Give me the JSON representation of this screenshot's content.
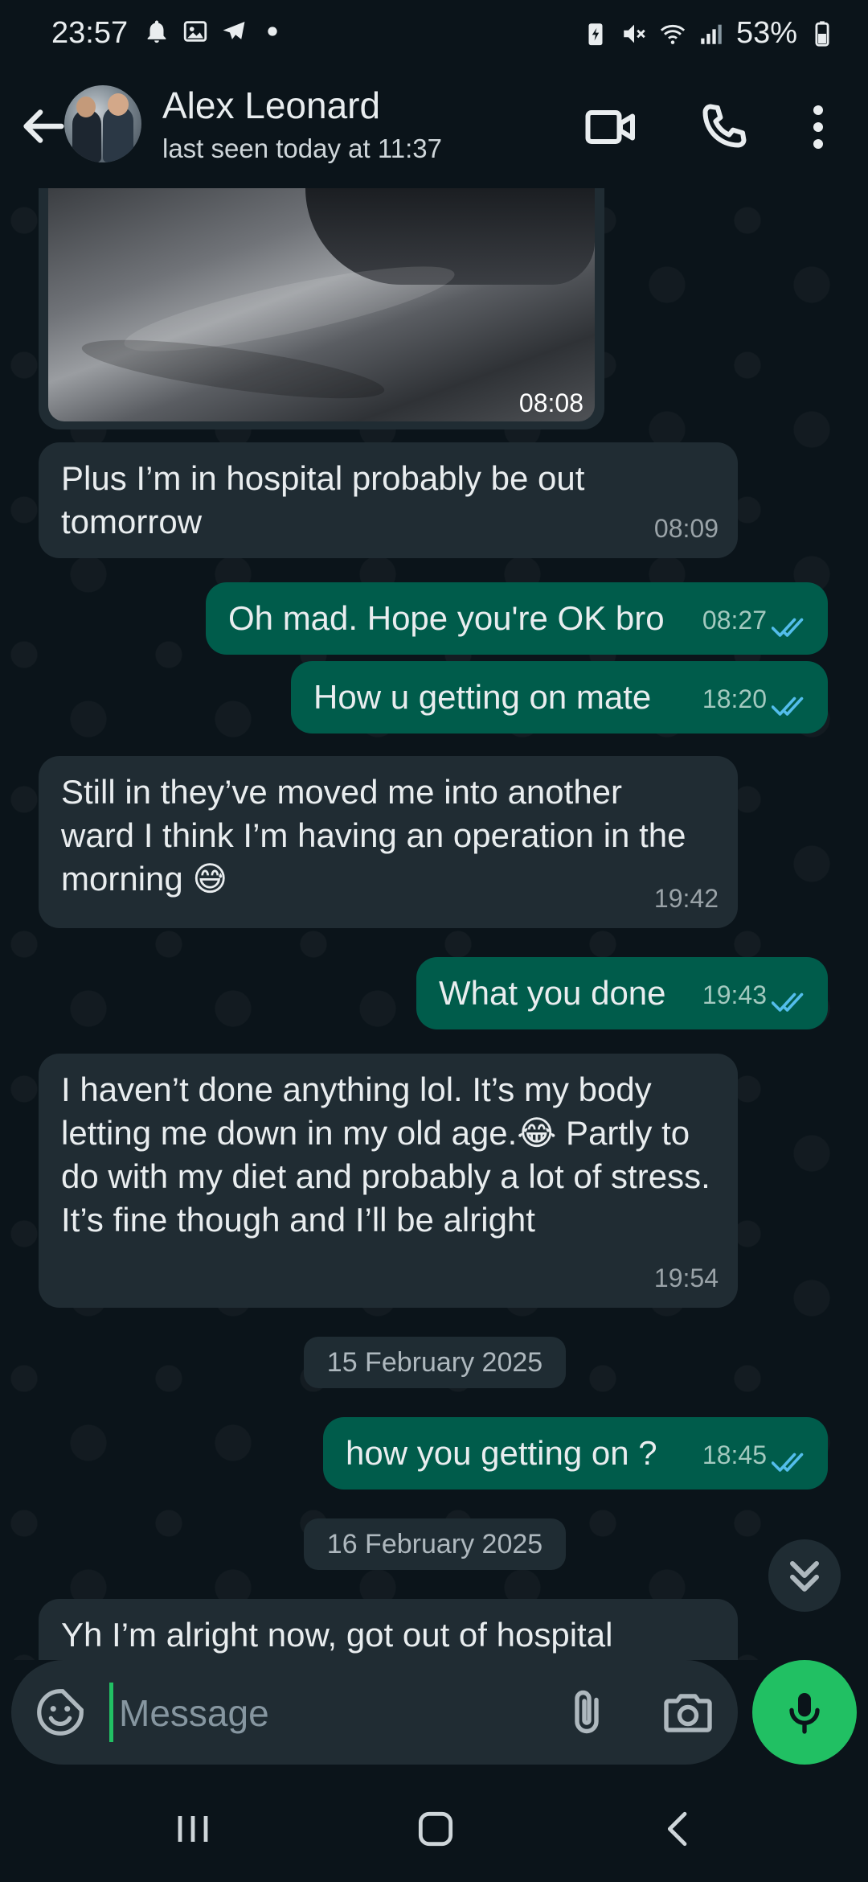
{
  "status_bar": {
    "time": "23:57",
    "battery_percent": "53%",
    "left_icons": [
      "bell-icon",
      "gallery-icon",
      "telegram-icon",
      "dot-icon"
    ],
    "right_icons": [
      "battery-saver-icon",
      "mute-icon",
      "wifi-icon",
      "signal-icon",
      "battery-icon"
    ]
  },
  "header": {
    "contact_name": "Alex Leonard",
    "last_seen": "last seen today at 11:37",
    "icons": [
      "back-arrow-icon",
      "video-call-icon",
      "phone-icon",
      "more-vert-icon"
    ]
  },
  "messages": [
    {
      "type": "image",
      "direction": "in",
      "time": "08:08"
    },
    {
      "direction": "in",
      "text": "Plus I’m in hospital probably be out tomorrow",
      "time": "08:09"
    },
    {
      "direction": "out",
      "text": "Oh mad. Hope you're OK bro",
      "time": "08:27",
      "read": true
    },
    {
      "direction": "out",
      "text": "How u getting on mate",
      "time": "18:20",
      "read": true
    },
    {
      "direction": "in",
      "text": "Still in they’ve moved me into another ward I think I’m having an operation in the morning 😅",
      "time": "19:42"
    },
    {
      "direction": "out",
      "text": "What you done",
      "time": "19:43",
      "read": true
    },
    {
      "direction": "in",
      "text": "I haven’t done anything lol. It’s my body letting me down in my old age.😂 Partly to do with my diet and probably a lot of stress. It’s fine though and I’ll be alright",
      "time": "19:54"
    },
    {
      "type": "date",
      "text": "15 February 2025"
    },
    {
      "direction": "out",
      "text": "how you getting on ?",
      "time": "18:45",
      "read": true
    },
    {
      "type": "date",
      "text": "16 February 2025"
    },
    {
      "direction": "in",
      "text": "Yh I’m alright now, got out of hospital"
    }
  ],
  "composer": {
    "placeholder": "Message",
    "icons": [
      "sticker-icon",
      "attach-icon",
      "camera-icon",
      "mic-icon"
    ]
  },
  "colors": {
    "background": "#0b141a",
    "incoming_bubble": "#202c33",
    "outgoing_bubble": "#005c4b",
    "accent_green": "#21c063",
    "read_ticks": "#53bdeb"
  }
}
